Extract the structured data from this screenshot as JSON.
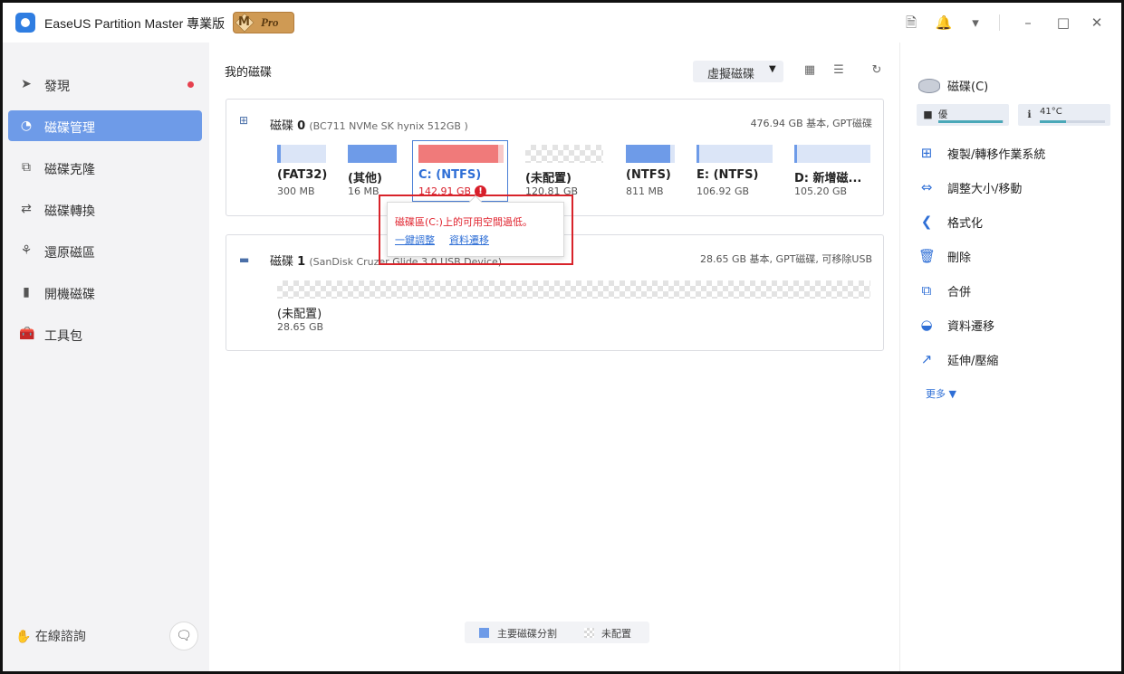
{
  "app": {
    "title": "EaseUS Partition Master 專業版",
    "badge_letter": "M",
    "badge_text": "Pro"
  },
  "sidebar": {
    "items": [
      {
        "label": "發現",
        "icon": "rocket-icon"
      },
      {
        "label": "磁碟管理",
        "icon": "pie-chart-icon",
        "active": true
      },
      {
        "label": "磁碟克隆",
        "icon": "clone-icon"
      },
      {
        "label": "磁碟轉換",
        "icon": "convert-icon"
      },
      {
        "label": "還原磁區",
        "icon": "recover-icon"
      },
      {
        "label": "開機磁碟",
        "icon": "usb-icon"
      },
      {
        "label": "工具包",
        "icon": "toolbox-icon"
      }
    ],
    "consult_label": "在線諮詢"
  },
  "main": {
    "title": "我的磁碟",
    "virtual_disk_label": "虛擬磁碟"
  },
  "disk0": {
    "name": "磁碟",
    "number": "0",
    "model": "(BC711 NVMe SK hynix 512GB )",
    "info": "476.94 GB 基本, GPT磁碟",
    "partitions": [
      {
        "label": "(FAT32)",
        "size": "300 MB",
        "used_fraction": 0.08
      },
      {
        "label": "(其他)",
        "size": "16 MB",
        "used_fraction": 1.0
      },
      {
        "label": "C: (NTFS)",
        "size": "142.91 GB",
        "used_fraction": 0.94,
        "warning": true
      },
      {
        "label": "(未配置)",
        "size": "120.81 GB",
        "unallocated": true
      },
      {
        "label": "(NTFS)",
        "size": "811 MB",
        "used_fraction": 0.9
      },
      {
        "label": "E: (NTFS)",
        "size": "106.92 GB",
        "used_fraction": 0.03
      },
      {
        "label": "D: 新增磁...",
        "size": "105.20 GB",
        "used_fraction": 0.03
      }
    ]
  },
  "disk1": {
    "name": "磁碟",
    "number": "1",
    "model": "(SanDisk Cruzer Glide 3.0 USB Device)",
    "info": "28.65 GB 基本, GPT磁碟, 可移除USB",
    "partitions": [
      {
        "label": "(未配置)",
        "size": "28.65 GB",
        "unallocated": true
      }
    ]
  },
  "tooltip": {
    "message": "磁碟區(C:)上的可用空間過低。",
    "link1": "一鍵調整",
    "link2": "資料遷移"
  },
  "legend": {
    "primary": "主要磁碟分割",
    "unallocated": "未配置"
  },
  "right_panel": {
    "disk_name": "磁碟(C)",
    "health_label": "優",
    "health_fraction": 0.98,
    "temperature": "41°C",
    "temperature_fraction": 0.4,
    "actions": [
      {
        "label": "複製/轉移作業系統",
        "icon": "windows-icon"
      },
      {
        "label": "調整大小/移動",
        "icon": "resize-icon"
      },
      {
        "label": "格式化",
        "icon": "format-icon"
      },
      {
        "label": "刪除",
        "icon": "trash-icon"
      },
      {
        "label": "合併",
        "icon": "merge-icon"
      },
      {
        "label": "資料遷移",
        "icon": "migrate-icon"
      },
      {
        "label": "延伸/壓縮",
        "icon": "extend-icon"
      }
    ],
    "more_label": "更多"
  },
  "colors": {
    "accent": "#6e9be8",
    "warning_bar": "#f07a7a",
    "error": "#d81e2a",
    "link": "#2f6fd6"
  }
}
